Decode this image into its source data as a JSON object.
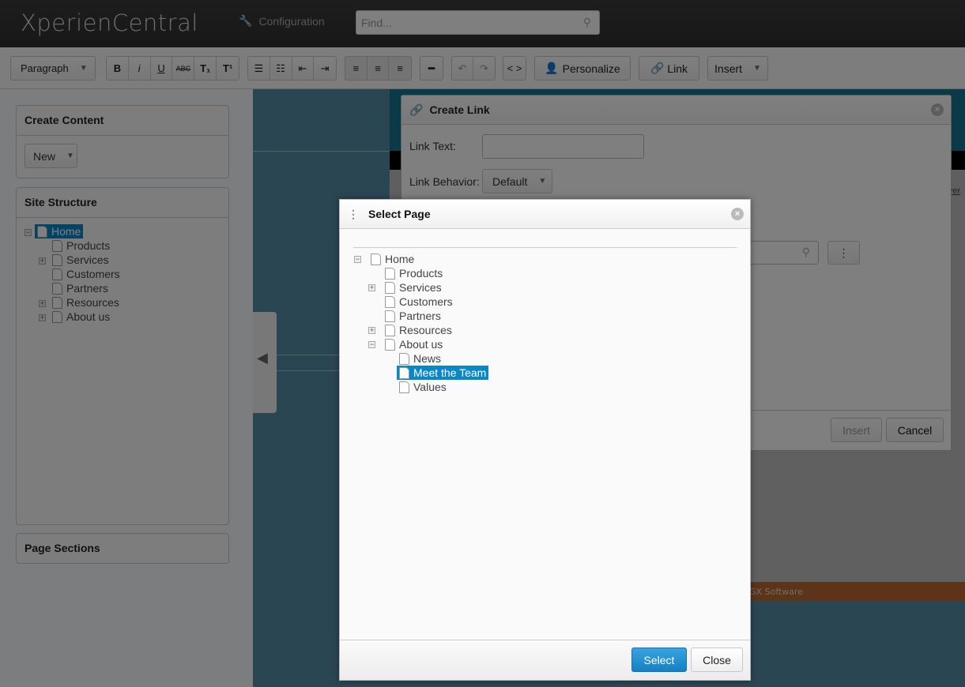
{
  "header": {
    "logo": "XperienCentral",
    "config_label": "Configuration",
    "search_placeholder": "Find..."
  },
  "toolbar": {
    "paragraph": "Paragraph",
    "bold": "B",
    "italic": "i",
    "underline": "U",
    "strike": "ABC",
    "subscript": "T₁",
    "superscript": "T¹",
    "code": "< >",
    "personalize": "Personalize",
    "link": "Link",
    "insert": "Insert"
  },
  "left": {
    "create_content": "Create Content",
    "new_label": "New",
    "site_structure": "Site Structure",
    "page_sections": "Page Sections",
    "tree": [
      "Home",
      "Products",
      "Services",
      "Customers",
      "Partners",
      "Resources",
      "About us"
    ]
  },
  "background": {
    "footer_text": "GX Software",
    "link_fragment": "ver"
  },
  "create_link": {
    "title": "Create Link",
    "link_text_label": "Link Text:",
    "link_text_value": "",
    "behavior_label": "Link Behavior:",
    "behavior_value": "Default",
    "insert": "Insert",
    "cancel": "Cancel"
  },
  "select_page": {
    "title": "Select Page",
    "tree": [
      "Home",
      "Products",
      "Services",
      "Customers",
      "Partners",
      "Resources",
      "About us",
      "News",
      "Meet the Team",
      "Values"
    ],
    "selected": "Meet the Team",
    "select": "Select",
    "close": "Close"
  },
  "colors": {
    "accent": "#0a87c8",
    "select_button": "#1481c4"
  }
}
